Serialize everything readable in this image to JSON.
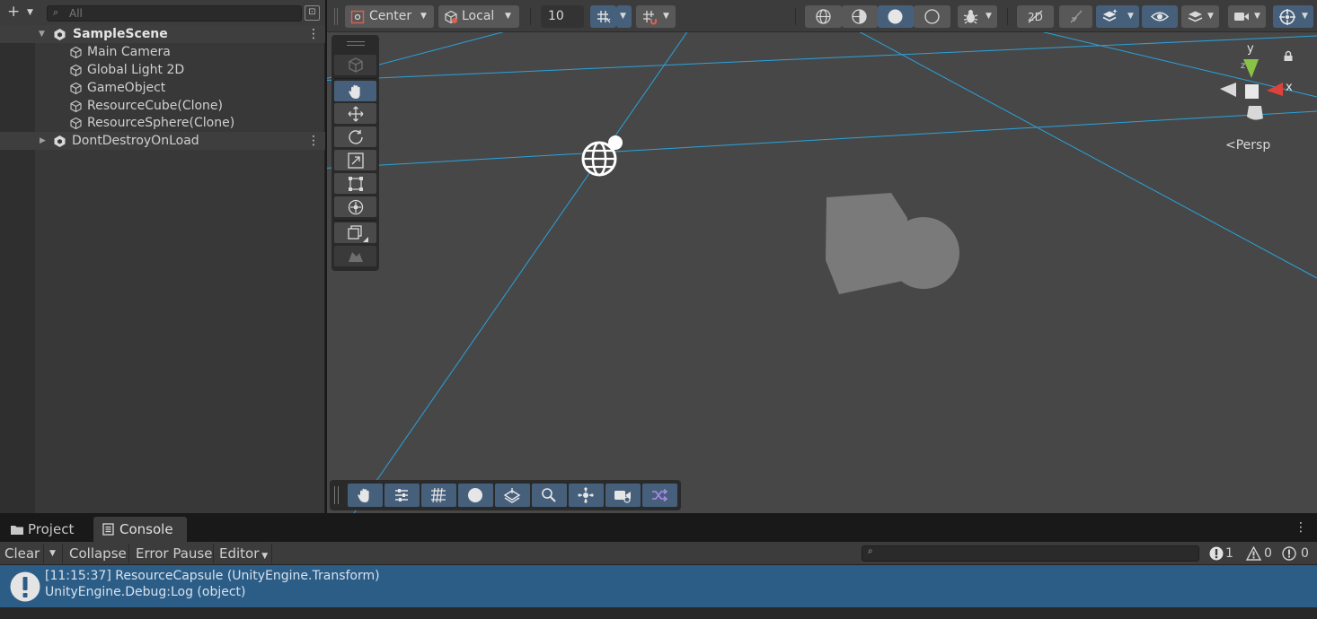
{
  "hierarchy": {
    "add_icon": "plus-icon",
    "search_placeholder": "All",
    "items": [
      {
        "label": "SampleScene",
        "kind": "scene",
        "expanded": true
      },
      {
        "label": "Main Camera",
        "kind": "gameobject"
      },
      {
        "label": "Global Light 2D",
        "kind": "gameobject"
      },
      {
        "label": "GameObject",
        "kind": "gameobject"
      },
      {
        "label": "ResourceCube(Clone)",
        "kind": "gameobject"
      },
      {
        "label": "ResourceSphere(Clone)",
        "kind": "gameobject"
      },
      {
        "label": "DontDestroyOnLoad",
        "kind": "scene",
        "expanded": false
      }
    ]
  },
  "scene_toolbar": {
    "pivot_mode": "Center",
    "pivot_rotation": "Local",
    "grid_snap_value": "10"
  },
  "scene_view": {
    "projection_label": "Persp",
    "gizmo_axes": {
      "x": "x",
      "y": "y"
    },
    "colors": {
      "background": "#474747",
      "grid_line": "#2aa3dd",
      "shape": "#7a7a7a",
      "active_button": "#46607c"
    }
  },
  "console": {
    "tabs": [
      {
        "label": "Project",
        "icon": "folder-icon",
        "active": false
      },
      {
        "label": "Console",
        "icon": "console-icon",
        "active": true
      }
    ],
    "toolbar": {
      "clear": "Clear",
      "collapse": "Collapse",
      "error_pause": "Error Pause",
      "editor": "Editor"
    },
    "counts": {
      "info": "1",
      "warning": "0",
      "error": "0"
    },
    "entries": [
      {
        "line1": "[11:15:37] ResourceCapsule (UnityEngine.Transform)",
        "line2": "UnityEngine.Debug:Log (object)",
        "type": "info"
      }
    ],
    "colors": {
      "selected_row": "#2c5d87"
    }
  }
}
